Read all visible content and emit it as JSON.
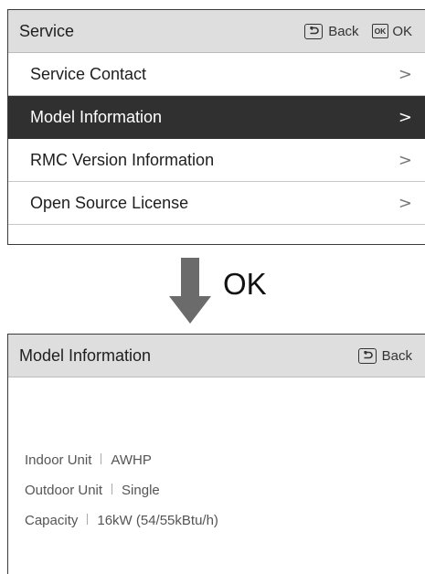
{
  "service_screen": {
    "title": "Service",
    "back_label": "Back",
    "ok_key_text": "OK",
    "ok_label": "OK",
    "items": [
      {
        "label": "Service Contact",
        "chevron": ">"
      },
      {
        "label": "Model Information",
        "chevron": ">",
        "selected": true
      },
      {
        "label": "RMC Version Information",
        "chevron": ">"
      },
      {
        "label": "Open Source License",
        "chevron": ">"
      }
    ]
  },
  "transition": {
    "label": "OK",
    "icon": "arrow-down-icon"
  },
  "model_screen": {
    "title": "Model Information",
    "back_label": "Back",
    "rows": [
      {
        "key": "Indoor Unit",
        "value": "AWHP"
      },
      {
        "key": "Outdoor Unit",
        "value": "Single"
      },
      {
        "key": "Capacity",
        "value": "16kW (54/55kBtu/h)"
      }
    ]
  },
  "colors": {
    "titlebar_bg": "#dedede",
    "selected_bg": "#303030",
    "arrow": "#6b6b6b"
  }
}
